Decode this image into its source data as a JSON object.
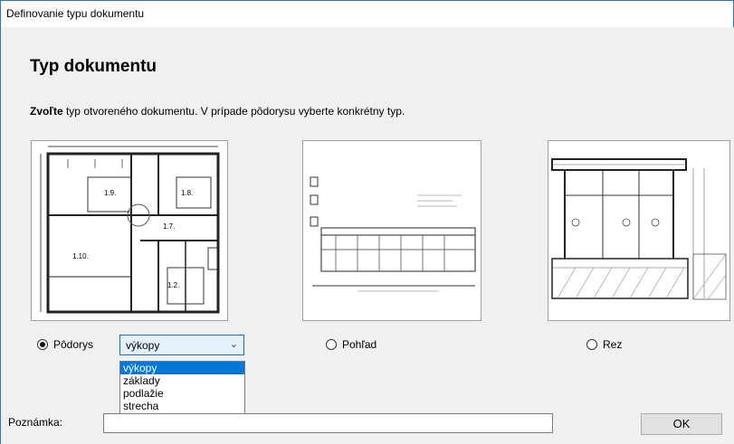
{
  "window": {
    "title": "Definovanie typu dokumentu"
  },
  "heading": "Typ dokumentu",
  "instruction": {
    "bold": "Zvoľte",
    "text": " typ otvoreného dokumentu. V prípade pôdorysu vyberte konkrétny typ."
  },
  "options": [
    {
      "label": "Pôdorys",
      "checked": true,
      "image_icon": "floor-plan-drawing"
    },
    {
      "label": "Pohľad",
      "checked": false,
      "image_icon": "elevation-drawing"
    },
    {
      "label": "Rez",
      "checked": false,
      "image_icon": "section-drawing"
    }
  ],
  "combo": {
    "value": "výkopy",
    "items": [
      "výkopy",
      "základy",
      "podlažie",
      "strecha"
    ],
    "selected_index": 0
  },
  "note": {
    "label": "Poznámka:",
    "value": ""
  },
  "ok_label": "OK",
  "colors": {
    "accent": "#0078d7",
    "window_border": "#2b74c6",
    "dialog_bg": "#f0f0f0"
  }
}
